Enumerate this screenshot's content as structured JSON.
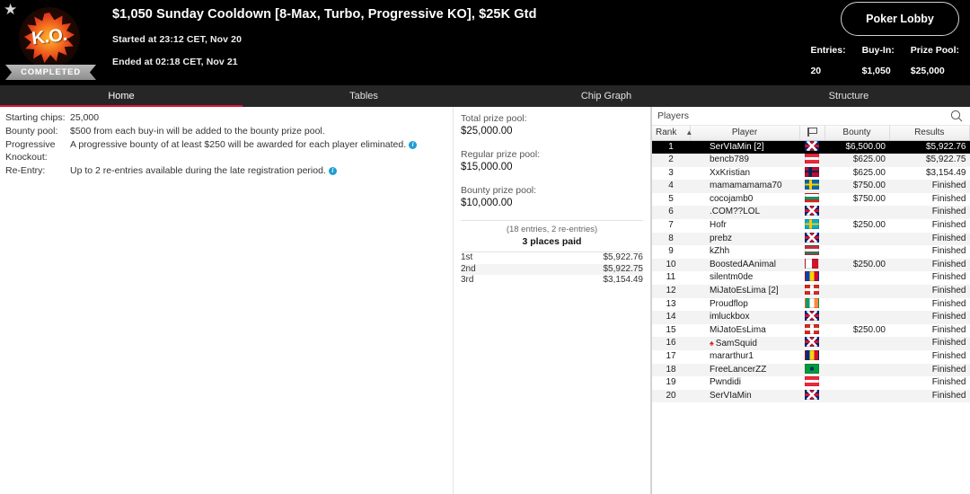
{
  "header": {
    "star_icon": "star-icon",
    "logo_text": "K.O.",
    "status": "COMPLETED",
    "title": "$1,050 Sunday Cooldown [8-Max, Turbo, Progressive KO], $25K Gtd",
    "started": "Started at 23:12 CET, Nov 20",
    "ended": "Ended at 02:18 CET, Nov 21",
    "lobby_button": "Poker Lobby",
    "stats": [
      {
        "label": "Entries:",
        "value": "20"
      },
      {
        "label": "Buy-In:",
        "value": "$1,050"
      },
      {
        "label": "Prize Pool:",
        "value": "$25,000"
      }
    ]
  },
  "tabs": [
    {
      "label": "Home",
      "active": true
    },
    {
      "label": "Tables",
      "active": false
    },
    {
      "label": "Chip Graph",
      "active": false
    },
    {
      "label": "Structure",
      "active": false
    }
  ],
  "info": {
    "rows": [
      {
        "label": "Starting chips:",
        "value": "25,000",
        "info_icon": false
      },
      {
        "label": "Bounty pool:",
        "value": "$500 from each buy-in will be added to the bounty prize pool.",
        "info_icon": false
      },
      {
        "label": "Progressive Knockout:",
        "value": "A progressive bounty of at least $250 will be awarded for each player eliminated.",
        "info_icon": true
      },
      {
        "label": "Re-Entry:",
        "value": "Up to 2 re-entries available during the late registration period.",
        "info_icon": true
      }
    ]
  },
  "prizes": {
    "groups": [
      {
        "label": "Total prize pool:",
        "amount": "$25,000.00"
      },
      {
        "label": "Regular prize pool:",
        "amount": "$15,000.00"
      },
      {
        "label": "Bounty prize pool:",
        "amount": "$10,000.00"
      }
    ],
    "entries_line": "(18 entries, 2 re-entries)",
    "places_paid": "3 places paid",
    "payouts": [
      {
        "position": "1st",
        "amount": "$5,922.76"
      },
      {
        "position": "2nd",
        "amount": "$5,922.75"
      },
      {
        "position": "3rd",
        "amount": "$3,154.49"
      }
    ]
  },
  "players_panel": {
    "title": "Players",
    "search_icon": "search-icon",
    "columns": {
      "rank": "Rank",
      "player": "Player",
      "flag": "flag-icon",
      "bounty": "Bounty",
      "results": "Results"
    },
    "sort_caret": "▲",
    "rows": [
      {
        "rank": "1",
        "player": "SerVIaMin [2]",
        "flag": "gb",
        "flag_colors": [
          "#00247d",
          "#ffffff",
          "#cf142b"
        ],
        "bounty": "$6,500.00",
        "results": "$5,922.76",
        "selected": true,
        "spade": false
      },
      {
        "rank": "2",
        "player": "bencb789",
        "flag": "at",
        "flag_colors": [
          "#ed2939",
          "#ffffff",
          "#ed2939"
        ],
        "bounty": "$625.00",
        "results": "$5,922.75",
        "selected": false,
        "spade": false
      },
      {
        "rank": "3",
        "player": "XxKristian",
        "flag": "no",
        "flag_colors": [
          "#ba0c2f",
          "#ffffff",
          "#00205b"
        ],
        "bounty": "$625.00",
        "results": "$3,154.49",
        "selected": false,
        "spade": false
      },
      {
        "rank": "4",
        "player": "mamamamama70",
        "flag": "se",
        "flag_colors": [
          "#006aa7",
          "#fecc00",
          "#006aa7"
        ],
        "bounty": "$750.00",
        "results": "Finished",
        "selected": false,
        "spade": false
      },
      {
        "rank": "5",
        "player": "cocojamb0",
        "flag": "bg",
        "flag_colors": [
          "#ffffff",
          "#00966e",
          "#d62612"
        ],
        "bounty": "$750.00",
        "results": "Finished",
        "selected": false,
        "spade": false
      },
      {
        "rank": "6",
        "player": ".COM??LOL",
        "flag": "gb",
        "flag_colors": [
          "#00247d",
          "#ffffff",
          "#cf142b"
        ],
        "bounty": "",
        "results": "Finished",
        "selected": false,
        "spade": false
      },
      {
        "rank": "7",
        "player": "Hofr",
        "flag": "kz",
        "flag_colors": [
          "#00afca",
          "#fec50c",
          "#00afca"
        ],
        "bounty": "$250.00",
        "results": "Finished",
        "selected": false,
        "spade": false
      },
      {
        "rank": "8",
        "player": "prebz",
        "flag": "gb",
        "flag_colors": [
          "#00247d",
          "#ffffff",
          "#cf142b"
        ],
        "bounty": "",
        "results": "Finished",
        "selected": false,
        "spade": false
      },
      {
        "rank": "9",
        "player": "kZhh",
        "flag": "hu",
        "flag_colors": [
          "#cd2a3e",
          "#ffffff",
          "#436f4d"
        ],
        "bounty": "",
        "results": "Finished",
        "selected": false,
        "spade": false
      },
      {
        "rank": "10",
        "player": "BoostedAAnimal",
        "flag": "mt",
        "flag_colors": [
          "#ffffff",
          "#ffffff",
          "#cf142b"
        ],
        "bounty": "$250.00",
        "results": "Finished",
        "selected": false,
        "spade": false
      },
      {
        "rank": "11",
        "player": "silentm0de",
        "flag": "md",
        "flag_colors": [
          "#0046ae",
          "#ffd200",
          "#cc092f"
        ],
        "bounty": "",
        "results": "Finished",
        "selected": false,
        "spade": false
      },
      {
        "rank": "12",
        "player": "MiJatoEsLima [2]",
        "flag": "ch",
        "flag_colors": [
          "#d52b1e",
          "#d52b1e",
          "#d52b1e"
        ],
        "bounty": "",
        "results": "Finished",
        "selected": false,
        "spade": false
      },
      {
        "rank": "13",
        "player": "Proudflop",
        "flag": "ie",
        "flag_colors": [
          "#169b62",
          "#ffffff",
          "#ff883e"
        ],
        "bounty": "",
        "results": "Finished",
        "selected": false,
        "spade": false
      },
      {
        "rank": "14",
        "player": "imluckbox",
        "flag": "gb",
        "flag_colors": [
          "#00247d",
          "#ffffff",
          "#cf142b"
        ],
        "bounty": "",
        "results": "Finished",
        "selected": false,
        "spade": false
      },
      {
        "rank": "15",
        "player": "MiJatoEsLima",
        "flag": "ch",
        "flag_colors": [
          "#d52b1e",
          "#d52b1e",
          "#d52b1e"
        ],
        "bounty": "$250.00",
        "results": "Finished",
        "selected": false,
        "spade": false
      },
      {
        "rank": "16",
        "player": "SamSquid",
        "flag": "gb",
        "flag_colors": [
          "#00247d",
          "#ffffff",
          "#cf142b"
        ],
        "bounty": "",
        "results": "Finished",
        "selected": false,
        "spade": true
      },
      {
        "rank": "17",
        "player": "mararthur1",
        "flag": "ro",
        "flag_colors": [
          "#002b7f",
          "#fcd116",
          "#ce1126"
        ],
        "bounty": "",
        "results": "Finished",
        "selected": false,
        "spade": false
      },
      {
        "rank": "18",
        "player": "FreeLancerZZ",
        "flag": "br",
        "flag_colors": [
          "#009b3a",
          "#fedf00",
          "#009b3a"
        ],
        "bounty": "",
        "results": "Finished",
        "selected": false,
        "spade": false
      },
      {
        "rank": "19",
        "player": "Pwndidi",
        "flag": "at",
        "flag_colors": [
          "#ed2939",
          "#ffffff",
          "#ed2939"
        ],
        "bounty": "",
        "results": "Finished",
        "selected": false,
        "spade": false
      },
      {
        "rank": "20",
        "player": "SerVIaMin",
        "flag": "gb",
        "flag_colors": [
          "#00247d",
          "#ffffff",
          "#cf142b"
        ],
        "bounty": "",
        "results": "Finished",
        "selected": false,
        "spade": false
      }
    ]
  },
  "colors": {
    "accent_red": "#e0103a",
    "header_bg": "#000000",
    "tabbar_bg": "#262626",
    "info_blue": "#1f9ed4",
    "spade_red": "#d1262c"
  }
}
